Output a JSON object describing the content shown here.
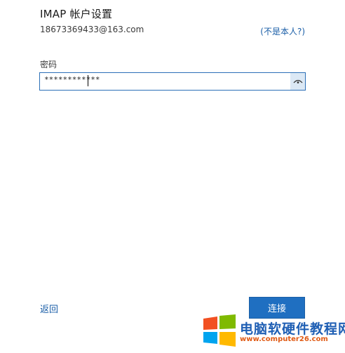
{
  "header": {
    "title": "IMAP 帐户设置",
    "account_email": "18673369433@163.com",
    "not_you_link": "(不是本人?)"
  },
  "password": {
    "label": "密码",
    "value": "************",
    "reveal_icon": "eye-icon"
  },
  "footer": {
    "back_label": "返回",
    "connect_label": "连接"
  },
  "watermark": {
    "name": "电脑软硬件教程网",
    "url": "www.computer26.com",
    "logo_icon": "windows-logo-icon"
  },
  "colors": {
    "accent": "#1f6fc1",
    "link": "#1a5ea7",
    "input_border": "#2b6fb7",
    "watermark_blue": "#1f5fb4",
    "watermark_orange": "#e05a14"
  }
}
